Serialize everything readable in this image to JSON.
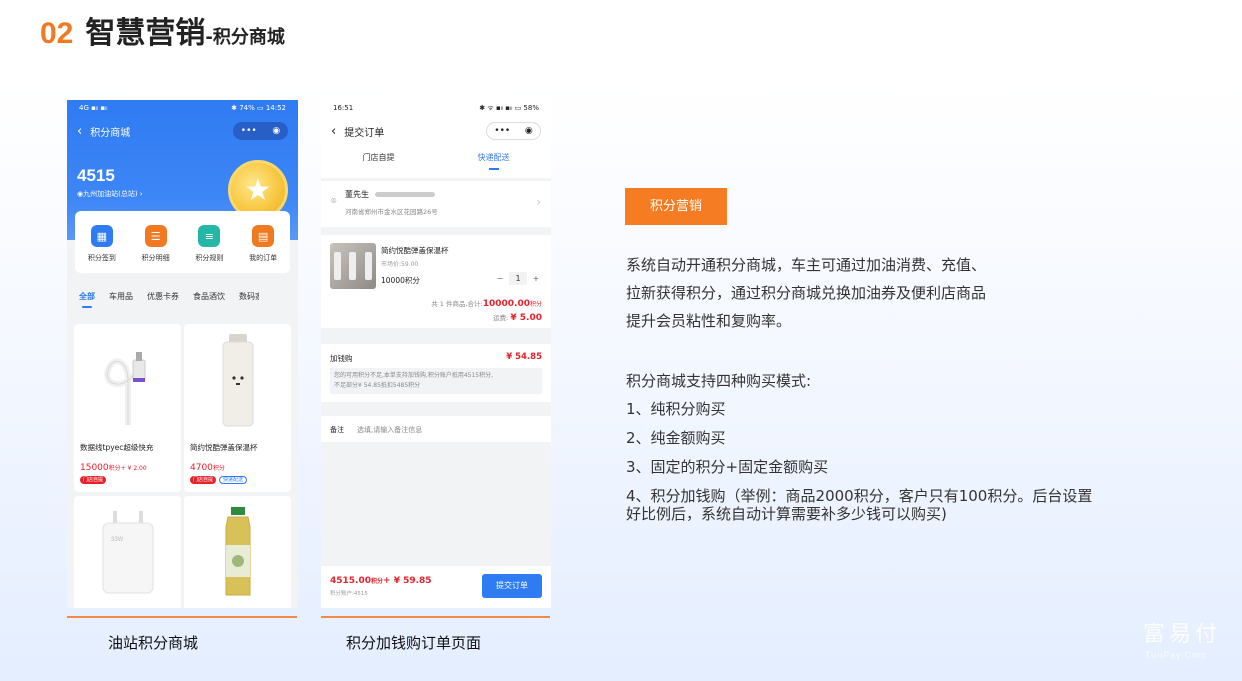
{
  "header": {
    "number": "02",
    "title": "智慧营销",
    "subtitle": "-积分商城"
  },
  "phone1": {
    "status_left": "4G ▪ₗₗ ▪ₗₗ",
    "status_right": "✱ 74% ▭ 14:52",
    "nav_title": "积分商城",
    "capsule_more": "•••",
    "capsule_close": "◉",
    "balance": "4515",
    "station": "◉九州加油站(总站) ›",
    "shortcuts": [
      {
        "label": "积分签到",
        "icon": "calendar-icon",
        "color": "#2f7bf2"
      },
      {
        "label": "积分明细",
        "icon": "ledger-icon",
        "color": "#f07a22"
      },
      {
        "label": "积分规则",
        "icon": "stack-icon",
        "color": "#25b6a6"
      },
      {
        "label": "我的订单",
        "icon": "order-icon",
        "color": "#f07a22"
      }
    ],
    "categories": [
      "全部",
      "车用品",
      "优惠卡券",
      "食品酒饮",
      "数码家"
    ],
    "products": [
      {
        "name": "数据线tpyec超级快充",
        "points": "15000",
        "points_unit": "积分",
        "plus": "+ ¥ 2.00",
        "tags": [
          "门店自提"
        ]
      },
      {
        "name": "简约悦酷弹盖保温杯",
        "points": "4700",
        "points_unit": "积分",
        "plus": "",
        "tags": [
          "门店自提",
          "快递配送"
        ]
      },
      {
        "name": "",
        "img_text": "33W"
      },
      {
        "name": ""
      }
    ],
    "caption": "油站积分商城"
  },
  "phone2": {
    "status_left": "16:51",
    "status_right": "✱ ᯤ ▪ₗₗ ▪ₗₗ ▭ 58%",
    "nav_title": "提交订单",
    "capsule_more": "•••",
    "capsule_close": "◉",
    "tab_pickup": "门店自提",
    "tab_delivery": "快递配送",
    "address_name": "董先生",
    "address_line": "河南省郑州市金水区花园路26号",
    "product_name": "简约悦酷弹盖保温杯",
    "market_price": "市场价:59.00",
    "points": "10000积分",
    "qty": "1",
    "total_prefix": "共 1 件商品,合计:",
    "total_value": "10000.00",
    "total_unit": "积分",
    "ship_label": "运费:",
    "ship_value": "¥ 5.00",
    "jqg_label": "加钱购",
    "jqg_amount": "¥ 54.85",
    "jqg_note_1": "您的可用积分不足,本单支持加钱购,积分账户抵用4515积分,",
    "jqg_note_2": "不足部分¥ 54.85抵扣5485积分",
    "remark_label": "备注",
    "remark_placeholder": "选填,请输入备注信息",
    "sum_points": "4515.00",
    "sum_points_unit": "积分",
    "sum_money": "+ ¥ 59.85",
    "account": "积分账户:4515",
    "submit": "提交订单",
    "caption": "积分加钱购订单页面"
  },
  "right": {
    "badge": "积分营销",
    "para": [
      "系统自动开通积分商城，车主可通过加油消费、充值、",
      "拉新获得积分，通过积分商城兑换加油券及便利店商品",
      "提升会员粘性和复购率。"
    ],
    "modes_title": "积分商城支持四种购买模式:",
    "modes": [
      "1、纯积分购买",
      "2、纯金额购买",
      "3、固定的积分+固定金额购买",
      "4、积分加钱购（举例：商品2000积分，客户只有100积分。后台设置",
      "好比例后，系统自动计算需要补多少钱可以购买)"
    ]
  },
  "watermark": {
    "cn": "富易付",
    "en": "TuiiPay.Com"
  },
  "colors": {
    "accent": "#f07a22",
    "primary": "#2f7bf2",
    "price_red": "#e8222a"
  }
}
